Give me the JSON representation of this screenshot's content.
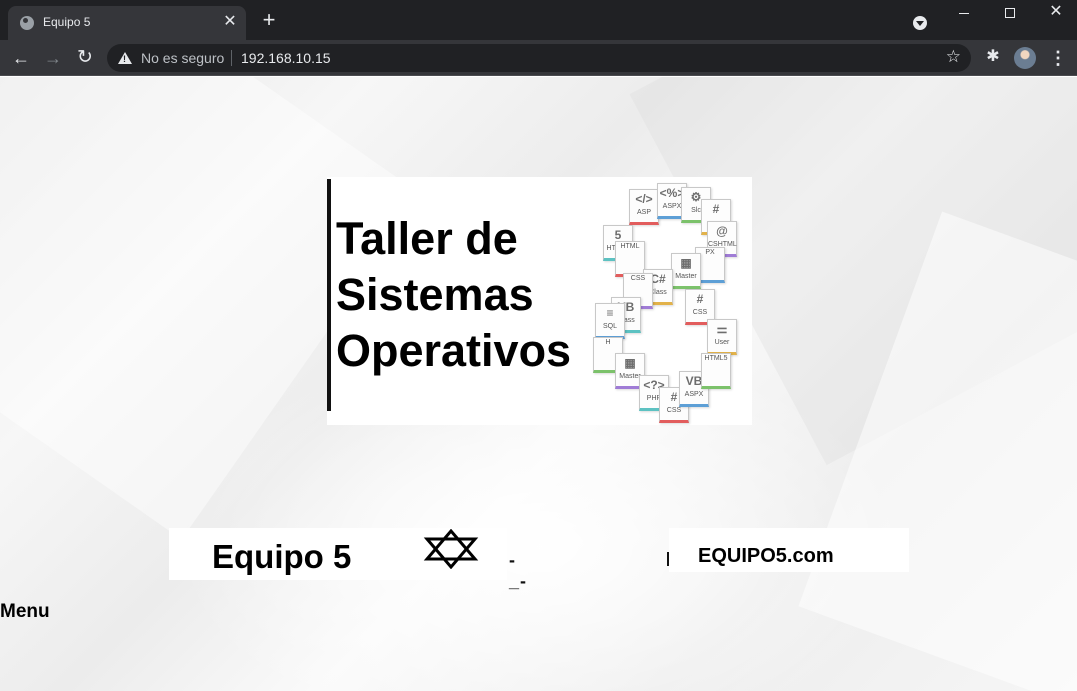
{
  "browser": {
    "tab_title": "Equipo 5",
    "tab_close": "✕",
    "new_tab": "+",
    "window_close": "✕",
    "security_label": "No es seguro",
    "url": "192.168.10.15",
    "back": "←",
    "forward": "→",
    "reload": "↻",
    "star": "☆",
    "extensions": "✱",
    "menu": "⋮"
  },
  "banner": {
    "title_lines": [
      "Taller de",
      "Sistemas",
      "Operativos"
    ],
    "file_icons": [
      {
        "sym": "</>",
        "label": "ASP"
      },
      {
        "sym": "<%>",
        "label": "ASPX"
      },
      {
        "sym": "⚙",
        "label": "Slc"
      },
      {
        "sym": "#",
        "label": ""
      },
      {
        "sym": "@",
        "label": "CSHTML"
      },
      {
        "sym": "5",
        "label": "HTML5"
      },
      {
        "sym": "",
        "label": "HTML"
      },
      {
        "sym": "",
        "label": "PX"
      },
      {
        "sym": "▦",
        "label": "Master"
      },
      {
        "sym": "C#",
        "label": "Class"
      },
      {
        "sym": "",
        "label": "CSS"
      },
      {
        "sym": "VB",
        "label": "Class"
      },
      {
        "sym": "#",
        "label": "CSS"
      },
      {
        "sym": "≡",
        "label": "SQL"
      },
      {
        "sym": "",
        "label": "H"
      },
      {
        "sym": "⚌",
        "label": "User"
      },
      {
        "sym": "▦",
        "label": "Master"
      },
      {
        "sym": "<?>",
        "label": "PHP"
      },
      {
        "sym": "#",
        "label": "CSS"
      },
      {
        "sym": "VB",
        "label": "ASPX"
      },
      {
        "sym": "",
        "label": "HTML5"
      }
    ]
  },
  "subbanner": {
    "title": "Equipo 5",
    "dash": "-_-",
    "domain": "EQUIPO5.com"
  },
  "menu": {
    "heading": "Menu"
  }
}
